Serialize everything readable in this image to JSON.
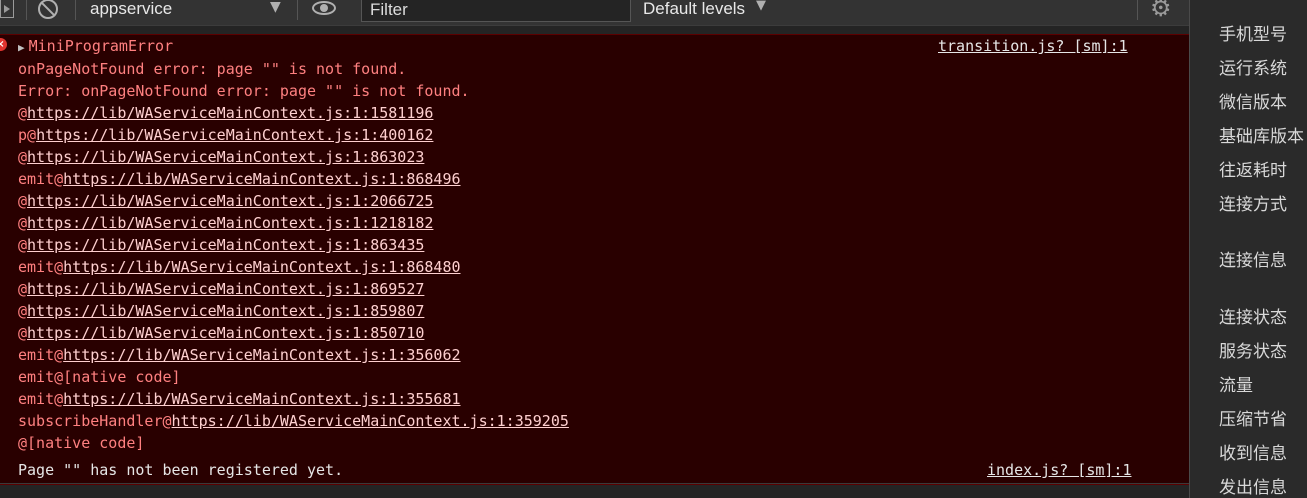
{
  "toolbar": {
    "context": "appservice",
    "filter_placeholder": "Filter",
    "levels": "Default levels"
  },
  "error": {
    "title": "MiniProgramError",
    "source": "transition.js? [sm]:1",
    "trace": [
      {
        "prefix": "onPageNotFound error: page \"\" is not found.",
        "url": ""
      },
      {
        "prefix": "Error: onPageNotFound error: page \"\" is not found.",
        "url": ""
      },
      {
        "prefix": "@",
        "url": "https://lib/WAServiceMainContext.js:1:1581196"
      },
      {
        "prefix": "p@",
        "url": "https://lib/WAServiceMainContext.js:1:400162"
      },
      {
        "prefix": "@",
        "url": "https://lib/WAServiceMainContext.js:1:863023"
      },
      {
        "prefix": "emit@",
        "url": "https://lib/WAServiceMainContext.js:1:868496"
      },
      {
        "prefix": "@",
        "url": "https://lib/WAServiceMainContext.js:1:2066725"
      },
      {
        "prefix": "@",
        "url": "https://lib/WAServiceMainContext.js:1:1218182"
      },
      {
        "prefix": "@",
        "url": "https://lib/WAServiceMainContext.js:1:863435"
      },
      {
        "prefix": "emit@",
        "url": "https://lib/WAServiceMainContext.js:1:868480"
      },
      {
        "prefix": "@",
        "url": "https://lib/WAServiceMainContext.js:1:869527"
      },
      {
        "prefix": "@",
        "url": "https://lib/WAServiceMainContext.js:1:859807"
      },
      {
        "prefix": "@",
        "url": "https://lib/WAServiceMainContext.js:1:850710"
      },
      {
        "prefix": "emit@",
        "url": "https://lib/WAServiceMainContext.js:1:356062"
      },
      {
        "prefix": "emit@[native code]",
        "url": ""
      },
      {
        "prefix": "emit@",
        "url": "https://lib/WAServiceMainContext.js:1:355681"
      },
      {
        "prefix": "subscribeHandler@",
        "url": "https://lib/WAServiceMainContext.js:1:359205"
      },
      {
        "prefix": "@[native code]",
        "url": ""
      }
    ]
  },
  "log": {
    "message": "Page \"\" has not been registered yet.",
    "source": "index.js? [sm]:1"
  },
  "side_panel": {
    "items": [
      {
        "label": "手机型号"
      },
      {
        "label": "运行系统"
      },
      {
        "label": "微信版本"
      },
      {
        "label": "基础库版本"
      },
      {
        "label": "往返耗时"
      },
      {
        "label": "连接方式"
      },
      {
        "label": "连接信息"
      },
      {
        "label": "连接状态"
      },
      {
        "label": "服务状态"
      },
      {
        "label": "流量"
      },
      {
        "label": "压缩节省"
      },
      {
        "label": "收到信息"
      },
      {
        "label": "发出信息"
      }
    ]
  },
  "colors": {
    "error_bg": "#290000",
    "error_text": "#ff8080",
    "panel_bg": "#2a2a2a"
  }
}
